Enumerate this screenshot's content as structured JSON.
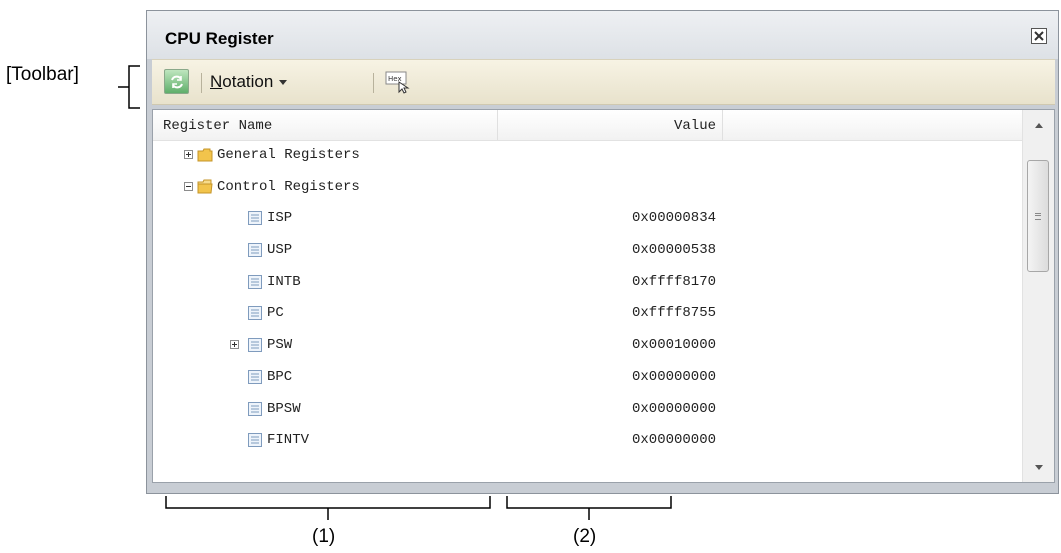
{
  "annotations": {
    "toolbar_label": "[Toolbar]",
    "col1_label": "(1)",
    "col2_label": "(2)"
  },
  "window": {
    "title": "CPU Register"
  },
  "toolbar": {
    "refresh_icon": "refresh-icon",
    "notation_accel": "N",
    "notation_rest": "otation",
    "hex_icon": "hex-icon"
  },
  "grid": {
    "col_name": "Register Name",
    "col_value": "Value",
    "rows": [
      {
        "name": "General Registers",
        "value": "",
        "icon": "folder-icon",
        "expander": "plus"
      },
      {
        "name": "Control Registers",
        "value": "",
        "icon": "folder-open-icon",
        "expander": "minus"
      },
      {
        "name": "ISP",
        "value": "0x00000834",
        "icon": "register-icon",
        "expander": "none"
      },
      {
        "name": "USP",
        "value": "0x00000538",
        "icon": "register-icon",
        "expander": "none"
      },
      {
        "name": "INTB",
        "value": "0xffff8170",
        "icon": "register-icon",
        "expander": "none"
      },
      {
        "name": "PC",
        "value": "0xffff8755",
        "icon": "register-icon",
        "expander": "none"
      },
      {
        "name": "PSW",
        "value": "0x00010000",
        "icon": "register-icon",
        "expander": "plus"
      },
      {
        "name": "BPC",
        "value": "0x00000000",
        "icon": "register-icon",
        "expander": "none"
      },
      {
        "name": "BPSW",
        "value": "0x00000000",
        "icon": "register-icon",
        "expander": "none"
      },
      {
        "name": "FINTV",
        "value": "0x00000000",
        "icon": "register-icon",
        "expander": "none"
      }
    ]
  },
  "colors": {
    "toolbar_bg": "#efead6",
    "window_frame": "#c8cdd4",
    "folder": "#f2c44c"
  }
}
